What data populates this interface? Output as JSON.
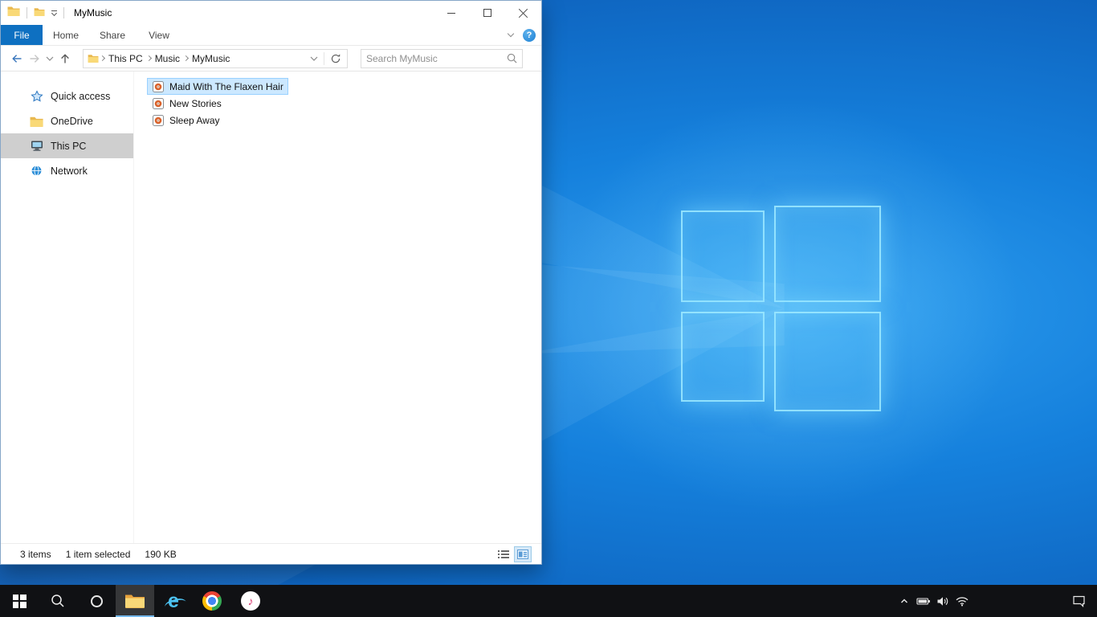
{
  "colors": {
    "accent": "#0078d7",
    "file_tab_bg": "#0e70c1",
    "selection_bg": "#cce8ff",
    "selection_border": "#99d1ff",
    "sidebar_selected_bg": "#cfcfcf",
    "taskbar_bg": "#101114",
    "taskbar_active_underline": "#76b9ed"
  },
  "glyphs": {
    "help": "?",
    "ie_logo": "e",
    "music_note": "♪"
  },
  "explorer": {
    "title": "MyMusic",
    "ribbon": {
      "file_tab": "File",
      "tabs": [
        "Home",
        "Share",
        "View"
      ]
    },
    "breadcrumb": [
      "This PC",
      "Music",
      "MyMusic"
    ],
    "search_placeholder": "Search MyMusic",
    "sidebar_items": [
      {
        "label": "Quick access"
      },
      {
        "label": "OneDrive"
      },
      {
        "label": "This PC"
      },
      {
        "label": "Network"
      }
    ],
    "files": [
      {
        "name": "Maid With The Flaxen Hair"
      },
      {
        "name": "New Stories"
      },
      {
        "name": "Sleep Away"
      }
    ],
    "status": {
      "items": "3 items",
      "selected": "1 item selected",
      "size": "190 KB"
    }
  }
}
